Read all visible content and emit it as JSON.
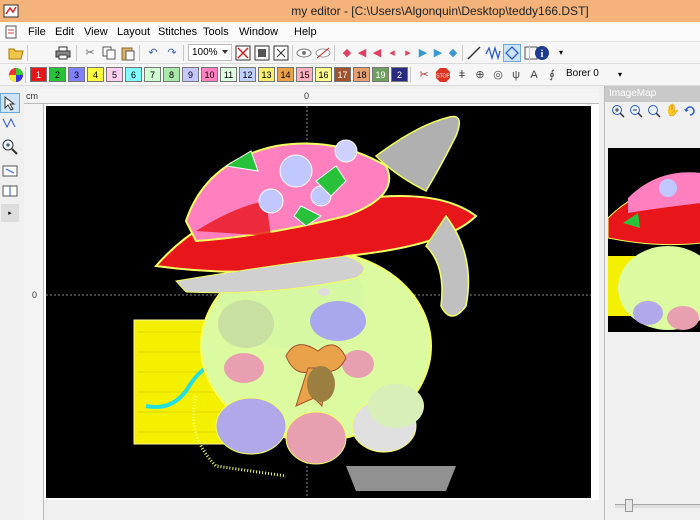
{
  "window": {
    "title": "my editor - [C:\\Users\\Algonquin\\Desktop\\teddy166.DST]"
  },
  "menu": [
    "File",
    "Edit",
    "View",
    "Layout",
    "Stitches",
    "Tools",
    "Window",
    "Help"
  ],
  "toolbar": {
    "zoom_value": "100%"
  },
  "colors": [
    {
      "label": "1",
      "color": "#e8151b"
    },
    {
      "label": "2",
      "color": "#27c23a"
    },
    {
      "label": "3",
      "color": "#7f7fff"
    },
    {
      "label": "4",
      "color": "#ffff3c"
    },
    {
      "label": "5",
      "color": "#ffd0f0"
    },
    {
      "label": "6",
      "color": "#7fffff"
    },
    {
      "label": "7",
      "color": "#d0ffd0"
    },
    {
      "label": "8",
      "color": "#a8e8a8"
    },
    {
      "label": "9",
      "color": "#c7c7ff"
    },
    {
      "label": "10",
      "color": "#ff7fbf"
    },
    {
      "label": "11",
      "color": "#e0ffe0"
    },
    {
      "label": "12",
      "color": "#c0d0ff"
    },
    {
      "label": "13",
      "color": "#f7ee70"
    },
    {
      "label": "14",
      "color": "#e9a14a"
    },
    {
      "label": "15",
      "color": "#ffb0c0"
    },
    {
      "label": "16",
      "color": "#ffff90"
    },
    {
      "label": "17",
      "color": "#a0522d"
    },
    {
      "label": "18",
      "color": "#e8a070"
    },
    {
      "label": "19",
      "color": "#6f9f5f"
    },
    {
      "label": "2",
      "color": "#2a2a80"
    }
  ],
  "thread": {
    "borer_label": "Borer 0"
  },
  "ruler": {
    "unit": "cm",
    "top_zero": "0",
    "left_zero": "0"
  },
  "image_map": {
    "title": "ImageMap"
  }
}
